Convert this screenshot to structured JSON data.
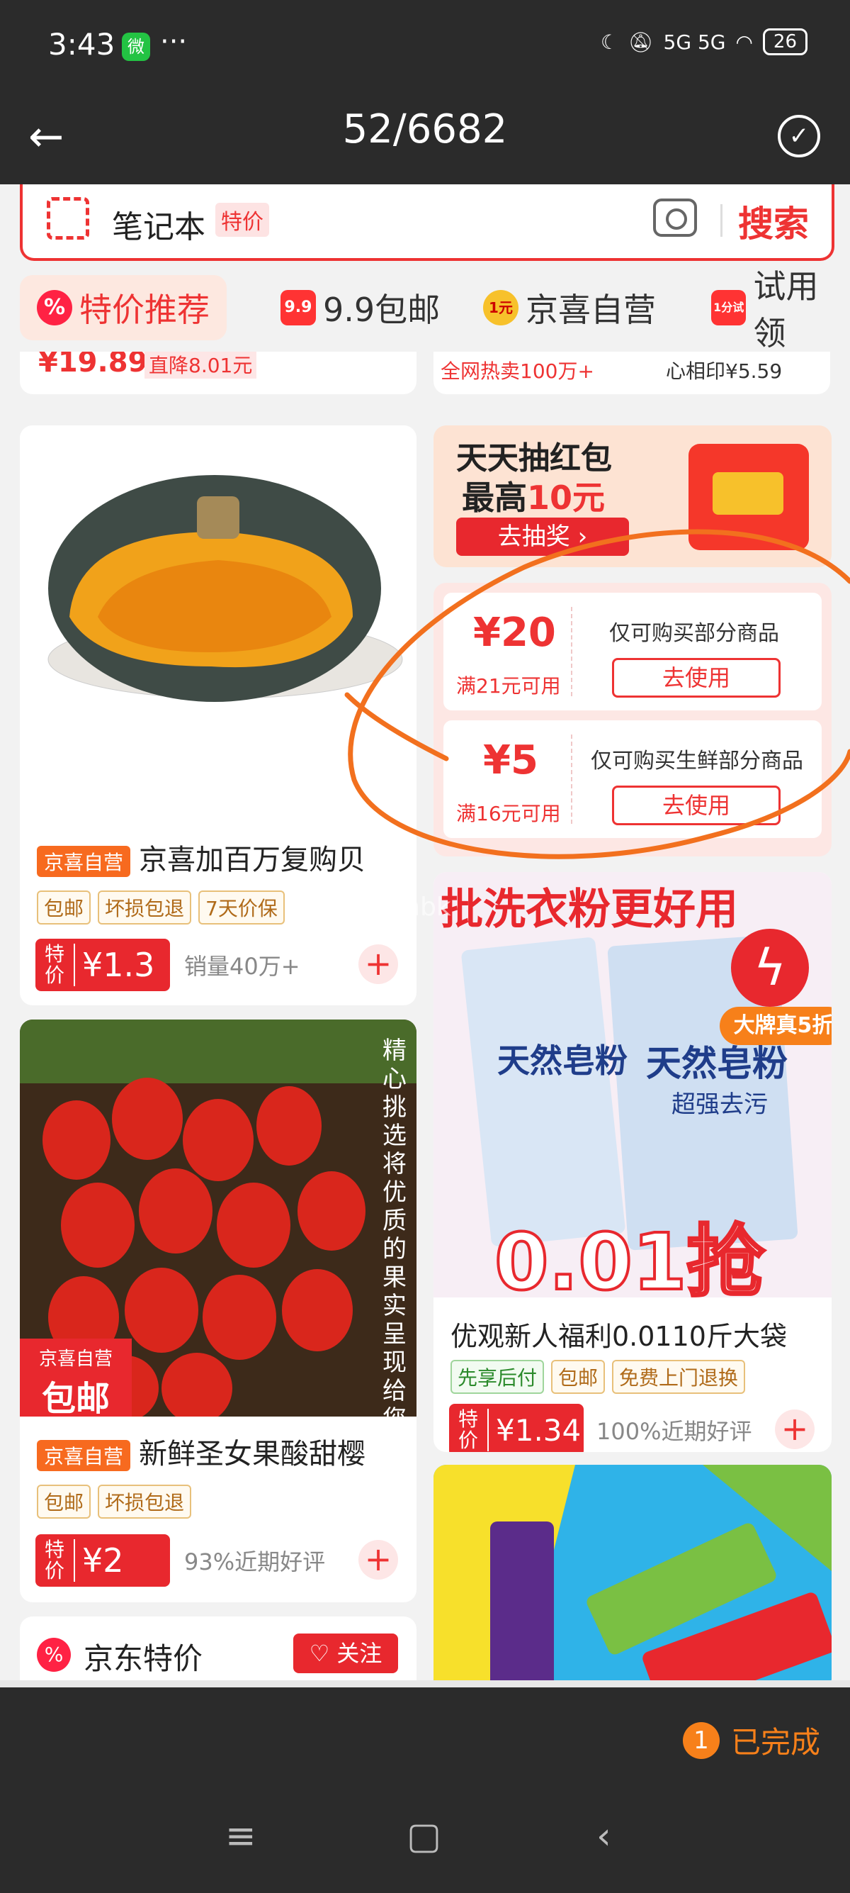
{
  "status": {
    "time": "3:43",
    "app_badge": "微",
    "dots": "···",
    "signal": "5G 5G",
    "battery": "26"
  },
  "header": {
    "counter": "52/6682"
  },
  "search": {
    "query": "笔记本",
    "badge": "特价",
    "button": "搜索"
  },
  "tabs": [
    {
      "label": "特价推荐",
      "icon": "%"
    },
    {
      "label": "9.9包邮",
      "icon": "9.9"
    },
    {
      "label": "京喜自营",
      "icon": "1元"
    },
    {
      "label": "试用领",
      "icon": "1分试"
    }
  ],
  "top_partial": {
    "price": "¥19.89",
    "cut": "直降8.01元",
    "hot": "全网热卖100万+",
    "mid": "心相印¥5.59"
  },
  "products": [
    {
      "badge": "京喜自营",
      "title": "京喜加百万复购贝",
      "tags": [
        "包邮",
        "坏损包退",
        "7天价保"
      ],
      "price_label": "特价",
      "price": "¥1.3",
      "sales": "销量40万+"
    },
    {
      "badge": "京喜自营",
      "title": "新鲜圣女果酸甜樱",
      "tags": [
        "包邮",
        "坏损包退"
      ],
      "price_label": "特价",
      "price": "¥2",
      "sales": "93%近期好评",
      "overlay_vertical": "精心挑选将优质的果实呈现给您",
      "overlay_badge_top": "京喜自营",
      "overlay_badge_main": "包邮"
    },
    {
      "title": "优观新人福利0.0110斤大袋",
      "tags": [
        "先享后付",
        "包邮",
        "免费上门退换"
      ],
      "price_label": "特价",
      "price": "¥1.34",
      "sales": "100%近期好评",
      "banner_top": "批洗衣粉更好用",
      "banner_brand": "天然皂粉",
      "banner_sub": "超强去污",
      "banner_price": "0.01抢",
      "banner_tag": "大牌真5折"
    }
  ],
  "red_packet": {
    "title": "天天抽红包",
    "line2_prefix": "最高",
    "line2_amount": "10元",
    "button": "去抽奖"
  },
  "coupons": [
    {
      "amount": "¥20",
      "condition": "满21元可用",
      "desc": "仅可购买部分商品",
      "button": "去使用"
    },
    {
      "amount": "¥5",
      "condition": "满16元可用",
      "desc": "仅可购买生鲜部分商品",
      "button": "去使用"
    }
  ],
  "jd_section": {
    "title": "京东特价",
    "follow": "关注"
  },
  "watermark": "亚当新mbk",
  "bottom": {
    "done_count": "1",
    "done_label": "已完成"
  },
  "colors": {
    "accent": "#e8282e",
    "orange": "#f7801a",
    "dark": "#2b2b2b"
  }
}
